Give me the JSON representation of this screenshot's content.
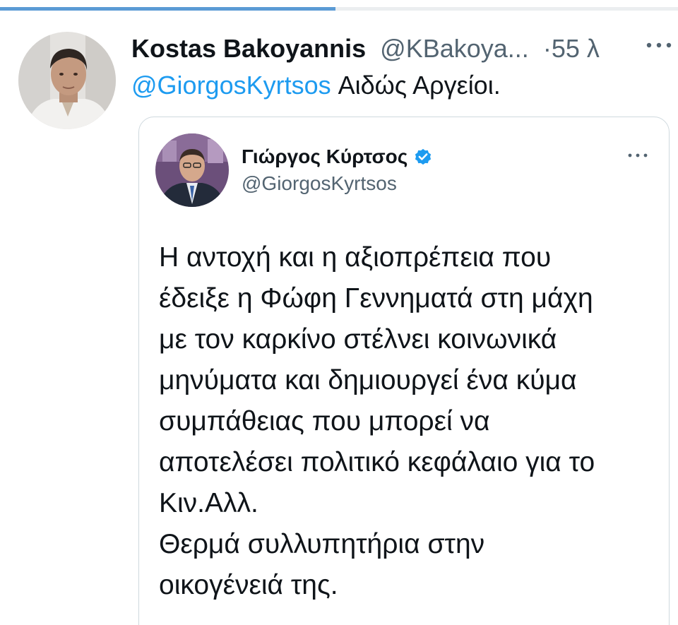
{
  "progress": {
    "fraction": 0.495,
    "color": "#5b9bd5"
  },
  "tweet": {
    "author_name": "Kostas Bakoyannis",
    "author_handle": "@KBakoya...",
    "timestamp": "·55 λ",
    "more_icon": "more-horizontal-icon",
    "reply_mention": "@GiorgosKyrtsos",
    "reply_text": " Αιδώς Αργείοι."
  },
  "quoted": {
    "author_name": "Γιώργος Κύρτσος",
    "author_handle": "@GiorgosKyrtsos",
    "verified_icon": "verified-badge-icon",
    "more_icon": "more-horizontal-icon",
    "body_lines": [
      "Η αντοχή και η αξιοπρέπεια που",
      "έδειξε η Φώφη Γεννηματά στη μάχη",
      "με τον καρκίνο στέλνει κοινωνικά",
      "μηνύματα και δημιουργεί ένα κύμα",
      "συμπάθειας που μπορεί να",
      "αποτελέσει πολιτικό κεφάλαιο για το",
      "Κιν.Αλλ.",
      "Θερμά συλλυπητήρια στην",
      "οικογένειά της."
    ]
  },
  "colors": {
    "link": "#1d9bf0",
    "secondary_text": "#536471",
    "verified": "#1d9bf0"
  }
}
